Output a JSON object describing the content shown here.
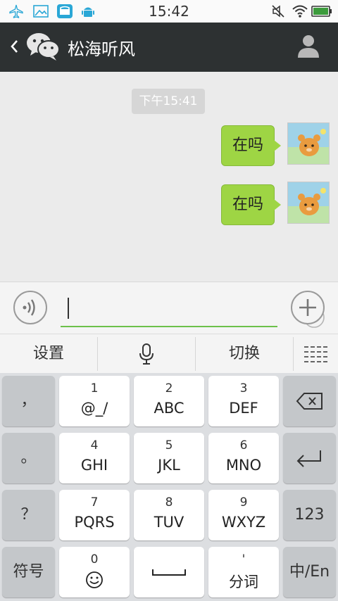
{
  "status_bar": {
    "time": "15:42",
    "left_icons": [
      "airplane-icon",
      "image-icon",
      "app-store-icon",
      "android-icon"
    ],
    "right_icons": [
      "mute-icon",
      "wifi-icon",
      "battery-icon"
    ]
  },
  "header": {
    "title": "松海听风",
    "back_icon": "chevron-left-icon",
    "app_icon": "wechat-icon",
    "profile_icon": "person-icon"
  },
  "chat": {
    "timestamp": "下午15:41",
    "messages": [
      {
        "text": "在吗",
        "direction": "outgoing"
      },
      {
        "text": "在吗",
        "direction": "outgoing"
      }
    ]
  },
  "input_bar": {
    "value": "",
    "voice_icon": "voice-icon",
    "emoji_icon": "smiley-icon",
    "plus_icon": "plus-icon"
  },
  "ime_toolbar": {
    "settings": "设置",
    "mic_icon": "microphone-icon",
    "switch": "切换",
    "menu_icon": "keyboard-menu-icon"
  },
  "keyboard": {
    "row1": {
      "left": "，",
      "k1_num": "1",
      "k1_letters": "@_/",
      "k2_num": "2",
      "k2_letters": "ABC",
      "k3_num": "3",
      "k3_letters": "DEF",
      "right_icon": "backspace-icon"
    },
    "row2": {
      "left": "。",
      "k1_num": "4",
      "k1_letters": "GHI",
      "k2_num": "5",
      "k2_letters": "JKL",
      "k3_num": "6",
      "k3_letters": "MNO",
      "right_icon": "enter-icon"
    },
    "row3": {
      "left": "？",
      "k1_num": "7",
      "k1_letters": "PQRS",
      "k2_num": "8",
      "k2_letters": "TUV",
      "k3_num": "9",
      "k3_letters": "WXYZ",
      "right": "123"
    },
    "row4": {
      "left": "符号",
      "k1_num": "0",
      "k1_icon": "smiley-icon",
      "space_icon": "space-icon",
      "k3_num": "'",
      "k3_label": "分词",
      "right": "中/En"
    }
  },
  "colors": {
    "header_bg": "#2d3132",
    "bubble_green": "#9ed544",
    "input_underline": "#6cc04a",
    "keyboard_bg": "#dcdee1"
  }
}
